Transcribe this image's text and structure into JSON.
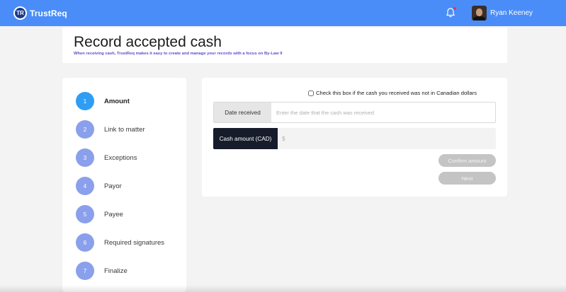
{
  "header": {
    "logo_initials": "TR",
    "brand": "TrustReq",
    "user_name": "Ryan Keeney"
  },
  "page": {
    "title": "Record accepted cash",
    "subtitle": "When receiving cash, TrustReq makes it easy to create and manage your records with a focus on By-Law 9"
  },
  "steps": [
    {
      "number": "1",
      "label": "Amount",
      "active": true
    },
    {
      "number": "2",
      "label": "Link to matter",
      "active": false
    },
    {
      "number": "3",
      "label": "Exceptions",
      "active": false
    },
    {
      "number": "4",
      "label": "Payor",
      "active": false
    },
    {
      "number": "5",
      "label": "Payee",
      "active": false
    },
    {
      "number": "6",
      "label": "Required signatures",
      "active": false
    },
    {
      "number": "7",
      "label": "Finalize",
      "active": false
    }
  ],
  "form": {
    "non_cad_checkbox_label": "Check this box if the cash you received was not in Canadian dollars",
    "non_cad_checked": false,
    "date_label": "Date received",
    "date_value": "",
    "date_placeholder": "Enter the date that the cash was received",
    "amount_label": "Cash amount (CAD)",
    "amount_value": "",
    "amount_placeholder": "$",
    "confirm_label": "Confirm amount",
    "next_label": "Next"
  },
  "colors": {
    "topbar": "#4a8df8",
    "active_step": "#2f9df4",
    "inactive_step": "#8aa0ec",
    "subtitle": "#5b4fc9",
    "amount_label_bg": "#171c2b",
    "disabled_button": "#c4c4c4",
    "notification_dot": "#e5354b"
  },
  "icons": {
    "logo": "trustreq-logo-icon",
    "bell": "bell-icon",
    "avatar": "user-avatar"
  }
}
